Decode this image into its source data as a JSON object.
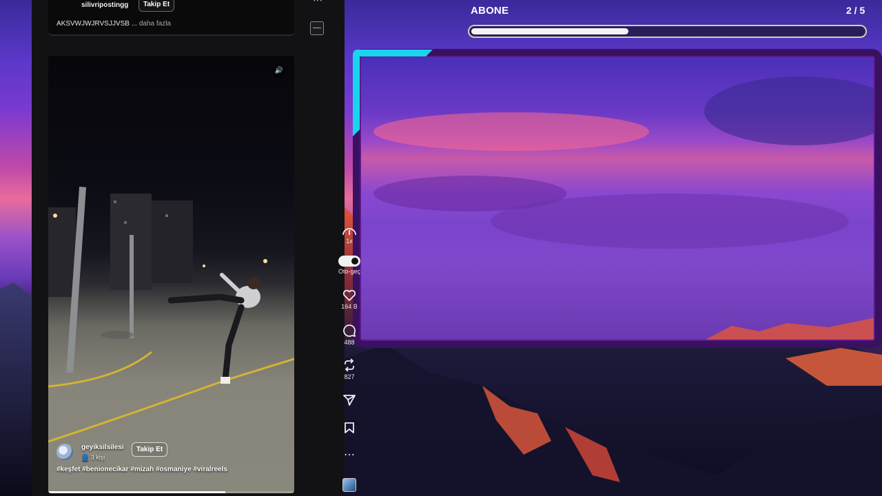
{
  "top_post": {
    "mini_logo": "",
    "username": "silivripostingg",
    "follow_label": "Takip Et",
    "caption": "AKSVWJWJRVSJJVSB ...",
    "more_label": "daha fazla"
  },
  "top_rail": {
    "more_icon": "⋯"
  },
  "video_post": {
    "username": "geyiksilsilesi",
    "members": "3 kişi",
    "follow_label": "Takip Et",
    "hashtags": "#keşfet #benionecikar #mizah #osmaniye #viralreels",
    "progress_fraction": 0.72
  },
  "rail": {
    "speed_label": "1x",
    "autoplay_label": "Oto-geç",
    "likes": "164 B",
    "comments": "488",
    "reposts": "827",
    "more_icon": "⋯"
  },
  "game": {
    "title": "ABONE",
    "counter": "2 / 5",
    "progress_fraction": 0.4
  },
  "colors": {
    "frame": "#3a1060",
    "frame_accent": "#19d4f0",
    "feed_bg": "#121214"
  }
}
